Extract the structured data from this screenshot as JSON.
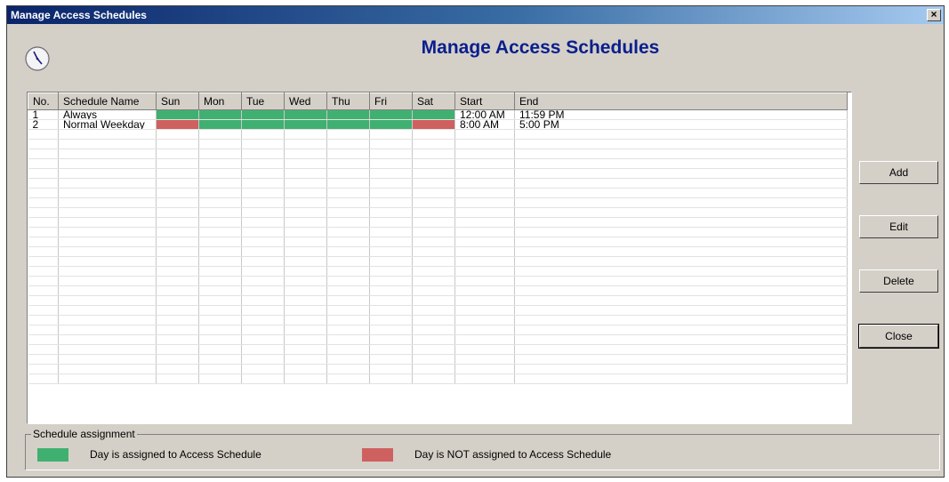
{
  "window": {
    "title": "Manage Access Schedules",
    "close_glyph": "×"
  },
  "heading": "Manage Access Schedules",
  "colors": {
    "assigned": "#40b070",
    "not_assigned": "#cf6060",
    "heading": "#0a1e8c"
  },
  "grid": {
    "columns": [
      "No.",
      "Schedule Name",
      "Sun",
      "Mon",
      "Tue",
      "Wed",
      "Thu",
      "Fri",
      "Sat",
      "Start",
      "End"
    ],
    "rows": [
      {
        "no": "1",
        "name": "Always",
        "days": [
          true,
          true,
          true,
          true,
          true,
          true,
          true
        ],
        "start": "12:00 AM",
        "end": "11:59 PM"
      },
      {
        "no": "2",
        "name": "Normal Weekday",
        "days": [
          false,
          true,
          true,
          true,
          true,
          true,
          false
        ],
        "start": "8:00 AM",
        "end": "5:00 PM"
      }
    ],
    "empty_rows": 26
  },
  "buttons": {
    "add": "Add",
    "edit": "Edit",
    "delete": "Delete",
    "close": "Close"
  },
  "legend": {
    "title": "Schedule assignment",
    "assigned": "Day is assigned to Access Schedule",
    "not_assigned": "Day is NOT assigned to Access Schedule"
  },
  "icons": {
    "clock": "clock-icon",
    "close": "close-icon"
  }
}
